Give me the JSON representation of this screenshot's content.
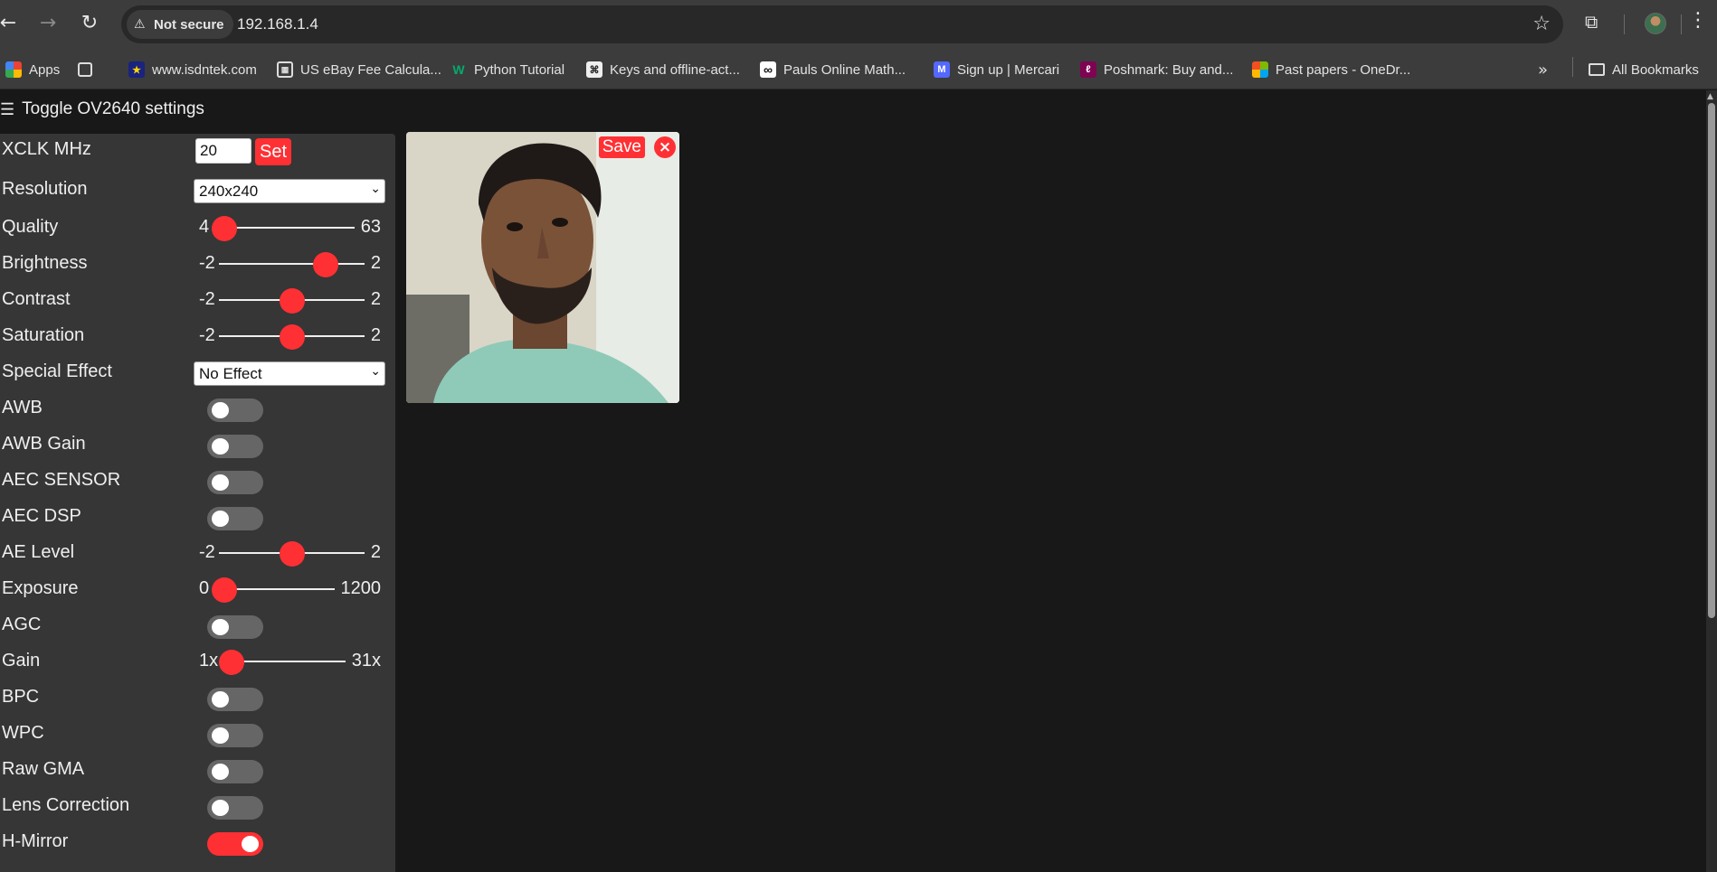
{
  "browser": {
    "security_label": "Not secure",
    "url": "192.168.1.4"
  },
  "bookmarks": [
    {
      "label": "Apps",
      "icon": "apps-grid-icon"
    },
    {
      "label": "www.isdntek.com",
      "icon": "isdntek-icon"
    },
    {
      "label": "US eBay Fee Calcula...",
      "icon": "calculator-icon"
    },
    {
      "label": "Python Tutorial",
      "icon": "w3-icon"
    },
    {
      "label": "Keys and offline-act...",
      "icon": "keys-icon"
    },
    {
      "label": "Pauls Online Math...",
      "icon": "infinity-icon"
    },
    {
      "label": "Sign up | Mercari",
      "icon": "mercari-icon"
    },
    {
      "label": "Poshmark: Buy and...",
      "icon": "poshmark-icon"
    },
    {
      "label": "Past papers - OneDr...",
      "icon": "microsoft-icon"
    }
  ],
  "all_bookmarks_label": "All Bookmarks",
  "panel": {
    "toggle_label": "Toggle OV2640 settings",
    "xclk": {
      "label": "XCLK MHz",
      "value": "20",
      "button": "Set"
    },
    "resolution": {
      "label": "Resolution",
      "value": "240x240"
    },
    "quality": {
      "label": "Quality",
      "min": "4",
      "max": "63",
      "value": 4
    },
    "brightness": {
      "label": "Brightness",
      "min": "-2",
      "max": "2",
      "value": 1
    },
    "contrast": {
      "label": "Contrast",
      "min": "-2",
      "max": "2",
      "value": 0
    },
    "saturation": {
      "label": "Saturation",
      "min": "-2",
      "max": "2",
      "value": 0
    },
    "special_effect": {
      "label": "Special Effect",
      "value": "No Effect"
    },
    "awb": {
      "label": "AWB",
      "on": false
    },
    "awb_gain": {
      "label": "AWB Gain",
      "on": false
    },
    "aec_sensor": {
      "label": "AEC SENSOR",
      "on": false
    },
    "aec_dsp": {
      "label": "AEC DSP",
      "on": false
    },
    "ae_level": {
      "label": "AE Level",
      "min": "-2",
      "max": "2",
      "value": 0
    },
    "exposure": {
      "label": "Exposure",
      "min": "0",
      "max": "1200",
      "value": 0
    },
    "agc": {
      "label": "AGC",
      "on": false
    },
    "gain": {
      "label": "Gain",
      "min": "1x",
      "max": "31x",
      "value": 0
    },
    "bpc": {
      "label": "BPC",
      "on": false
    },
    "wpc": {
      "label": "WPC",
      "on": false
    },
    "raw_gma": {
      "label": "Raw GMA",
      "on": false
    },
    "lens_correction": {
      "label": "Lens Correction",
      "on": false
    },
    "h_mirror": {
      "label": "H-Mirror",
      "on": true
    }
  },
  "stream": {
    "save_label": "Save",
    "close_label": "×"
  },
  "colors": {
    "accent": "#ff3034",
    "panel": "#363636",
    "page_bg": "#181818"
  }
}
